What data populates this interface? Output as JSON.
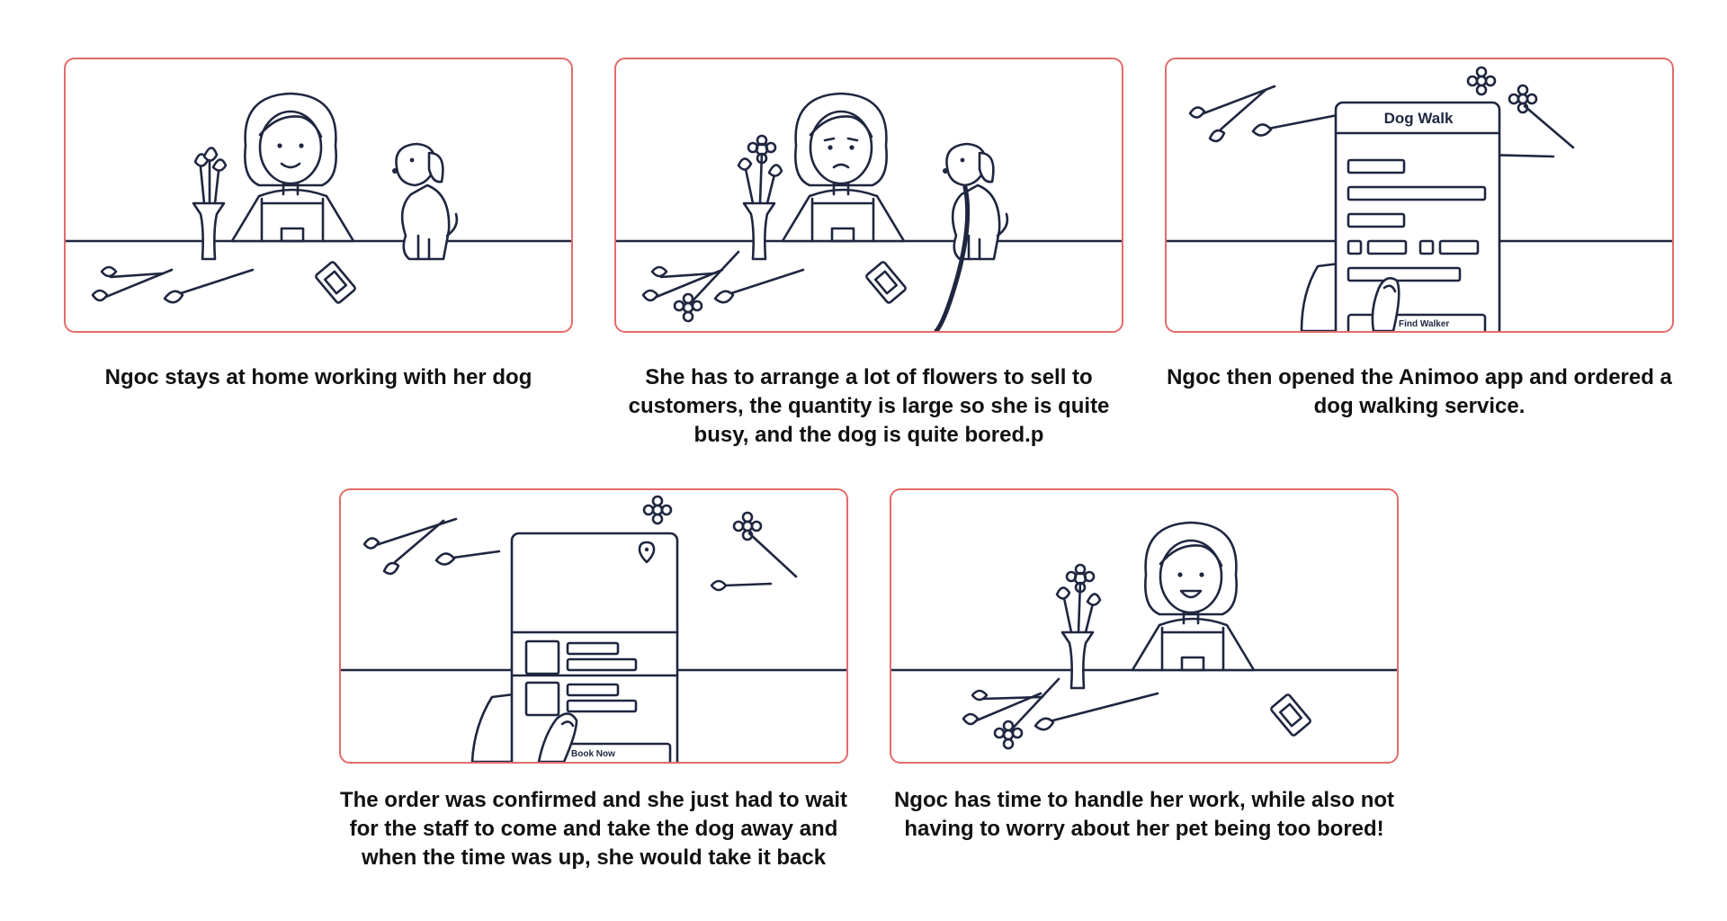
{
  "panels": [
    {
      "caption": "Ngoc stays at home working with her dog"
    },
    {
      "caption": "She has to arrange a lot of flowers to sell to customers, the quantity is large so she is quite busy, and the dog is quite bored.p"
    },
    {
      "caption": "Ngoc then opened the Animoo app and ordered a dog walking service.",
      "phone_title": "Dog Walk",
      "phone_button": "Find Walker"
    },
    {
      "caption": "The order was confirmed and she just had to wait for the staff to come and take the dog away and when the time was up, she would take it back",
      "phone_button": "Book Now"
    },
    {
      "caption": "Ngoc has time to handle her work, while also not having to worry about her pet being too bored!"
    }
  ],
  "icons": [
    "woman-icon",
    "dog-icon",
    "flower-vase-icon",
    "rose-icon",
    "phone-icon",
    "map-pin-icon",
    "hand-icon"
  ],
  "colors": {
    "panel_border": "#e36b6b",
    "ink": "#1f2640",
    "caption_text": "#111111"
  }
}
